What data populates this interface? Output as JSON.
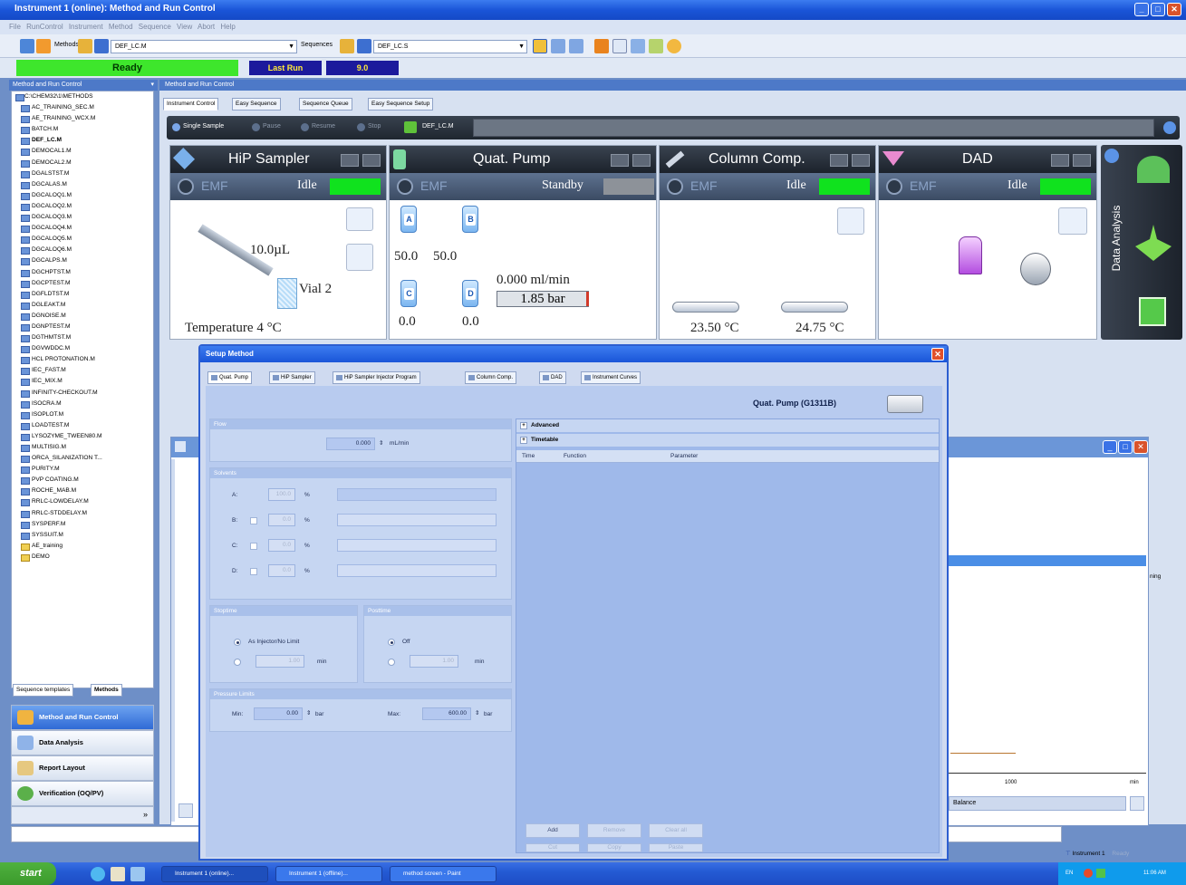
{
  "window": {
    "title": "Instrument 1 (online): Method and Run Control"
  },
  "menu": [
    "File",
    "RunControl",
    "Instrument",
    "Method",
    "Sequence",
    "View",
    "Abort",
    "Help"
  ],
  "toolbar": {
    "methods_label": "Methods",
    "method_value": "DEF_LC.M",
    "sequences_label": "Sequences",
    "sequence_value": "DEF_LC.S"
  },
  "status": {
    "state": "Ready",
    "last_run_label": "Last Run",
    "last_run_value": "9.0"
  },
  "nav": {
    "header": "Method and Run Control",
    "tree": [
      "C:\\CHEM32\\1\\METHODS",
      "AC_TRAINING_SEC.M",
      "AE_TRAINING_WCX.M",
      "BATCH.M",
      "DEF_LC.M",
      "DEMOCAL1.M",
      "DEMOCAL2.M",
      "DGALSTST.M",
      "DGCALAS.M",
      "DGCALOQ1.M",
      "DGCALOQ2.M",
      "DGCALOQ3.M",
      "DGCALOQ4.M",
      "DGCALOQ5.M",
      "DGCALOQ6.M",
      "DGCALPS.M",
      "DGCHPTST.M",
      "DGCPTEST.M",
      "DGFLDTST.M",
      "DGLEAKT.M",
      "DGNOISE.M",
      "DGNPTEST.M",
      "DGTHMTST.M",
      "DGVWDDC.M",
      "HCL PROTONATION.M",
      "IEC_FAST.M",
      "IEC_MIX.M",
      "INFINITY-CHECKOUT.M",
      "ISOCRA.M",
      "ISOPLOT.M",
      "LOADTEST.M",
      "LYSOZYME_TWEEN80.M",
      "MULTISIG.M",
      "ORCA_SILANIZATION T...",
      "PURITY.M",
      "PVP COATING.M",
      "ROCHE_MAB.M",
      "RRLC-LOWDELAY.M",
      "RRLC-STDDELAY.M",
      "SYSPERF.M",
      "SYSSUIT.M",
      "AE_training",
      "DEMO"
    ],
    "tabs": [
      "Sequence templates",
      "Methods"
    ],
    "buttons": [
      "Method and Run Control",
      "Data Analysis",
      "Report Layout",
      "Verification (OQ/PV)"
    ]
  },
  "main": {
    "header": "Method and Run Control",
    "tabs": [
      "Instrument Control",
      "Easy Sequence",
      "Sequence Queue",
      "Easy Sequence Setup"
    ],
    "runbar": {
      "single": "Single Sample",
      "pause": "Pause",
      "resume": "Resume",
      "stop": "Stop",
      "method": "DEF_LC.M"
    },
    "modules": {
      "sampler": {
        "title": "HiP Sampler",
        "emf": "EMF",
        "state": "Idle",
        "volume": "10.0µL",
        "vial": "Vial 2",
        "temperature": "Temperature 4 °C"
      },
      "pump": {
        "title": "Quat. Pump",
        "emf": "EMF",
        "state": "Standby",
        "a": "A",
        "b": "B",
        "c": "C",
        "d": "D",
        "a_val": "50.0",
        "b_val": "50.0",
        "c_val": "0.0",
        "d_val": "0.0",
        "flow": "0.000 ml/min",
        "pressure": "1.85 bar"
      },
      "column": {
        "title": "Column Comp.",
        "emf": "EMF",
        "state": "Idle",
        "left_temp": "23.50 °C",
        "right_temp": "24.75 °C"
      },
      "dad": {
        "title": "DAD",
        "emf": "EMF",
        "state": "Idle"
      },
      "data_analysis": "Data Analysis"
    },
    "bg_window": {
      "side_text": "ning",
      "axis_tick": "1000",
      "axis_unit": "min",
      "balance": "Balance"
    }
  },
  "dialog": {
    "title": "Setup Method",
    "tabs": [
      "Quat. Pump",
      "HiP Sampler",
      "HiP Sampler Injector Program",
      "Column Comp.",
      "DAD",
      "Instrument Curves"
    ],
    "module_name": "Quat. Pump (G1311B)",
    "flow": {
      "header": "Flow",
      "value": "0.000",
      "unit": "mL/min"
    },
    "solvents": {
      "header": "Solvents",
      "rows": [
        {
          "label": "A:",
          "value": "100.0",
          "unit": "%"
        },
        {
          "label": "B:",
          "value": "0.0",
          "unit": "%"
        },
        {
          "label": "C:",
          "value": "0.0",
          "unit": "%"
        },
        {
          "label": "D:",
          "value": "0.0",
          "unit": "%"
        }
      ]
    },
    "stoptime": {
      "header": "Stoptime",
      "option1": "As Injector/No Limit",
      "value": "1.00",
      "unit": "min"
    },
    "posttime": {
      "header": "Posttime",
      "option1": "Off",
      "value": "1.00",
      "unit": "min"
    },
    "pressure": {
      "header": "Pressure Limits",
      "min_label": "Min:",
      "min_value": "0.00",
      "max_label": "Max:",
      "max_value": "600.00",
      "unit": "bar"
    },
    "advanced": "Advanced",
    "timetable": {
      "header": "Timetable",
      "columns": [
        "Time",
        "Function",
        "Parameter"
      ]
    },
    "buttons": [
      "Add",
      "Remove",
      "Clear all",
      "Cut",
      "Copy",
      "Paste"
    ]
  },
  "taskbar": {
    "start": "start",
    "tasks": [
      "Instrument 1 (online)...",
      "Instrument 1 (offline)...",
      "method screen - Paint"
    ],
    "tray_lang": "EN",
    "clock": "11:06 AM",
    "instrument_status": "Instrument 1",
    "ready": "Ready"
  },
  "colors": {
    "ready_green": "#3ee62c",
    "status_green": "#10e21e",
    "xp_blue": "#245bd4"
  }
}
